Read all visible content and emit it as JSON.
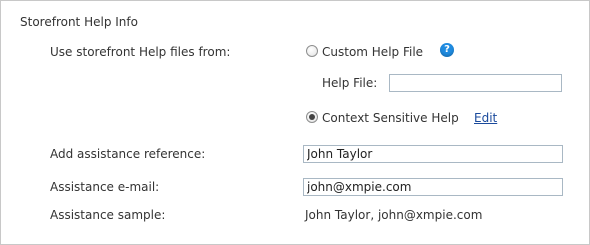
{
  "section": {
    "title": "Storefront Help Info"
  },
  "help_source": {
    "label": "Use storefront Help files from:",
    "custom_option_label": "Custom Help File",
    "help_icon_glyph": "?",
    "help_file_label": "Help File:",
    "help_file_value": "",
    "context_option_label": "Context Sensitive Help",
    "edit_link": "Edit",
    "selected": "context"
  },
  "assistance": {
    "reference_label": "Add assistance reference:",
    "reference_value": "John Taylor",
    "email_label": "Assistance e-mail:",
    "email_value": "john@xmpie.com",
    "sample_label": "Assistance sample:",
    "sample_value": "John Taylor, john@xmpie.com"
  },
  "colors": {
    "panel_border": "#c8c8c8",
    "link": "#1a4a9c",
    "help_icon": "#1f8be0",
    "input_border": "#a9b8c4"
  }
}
